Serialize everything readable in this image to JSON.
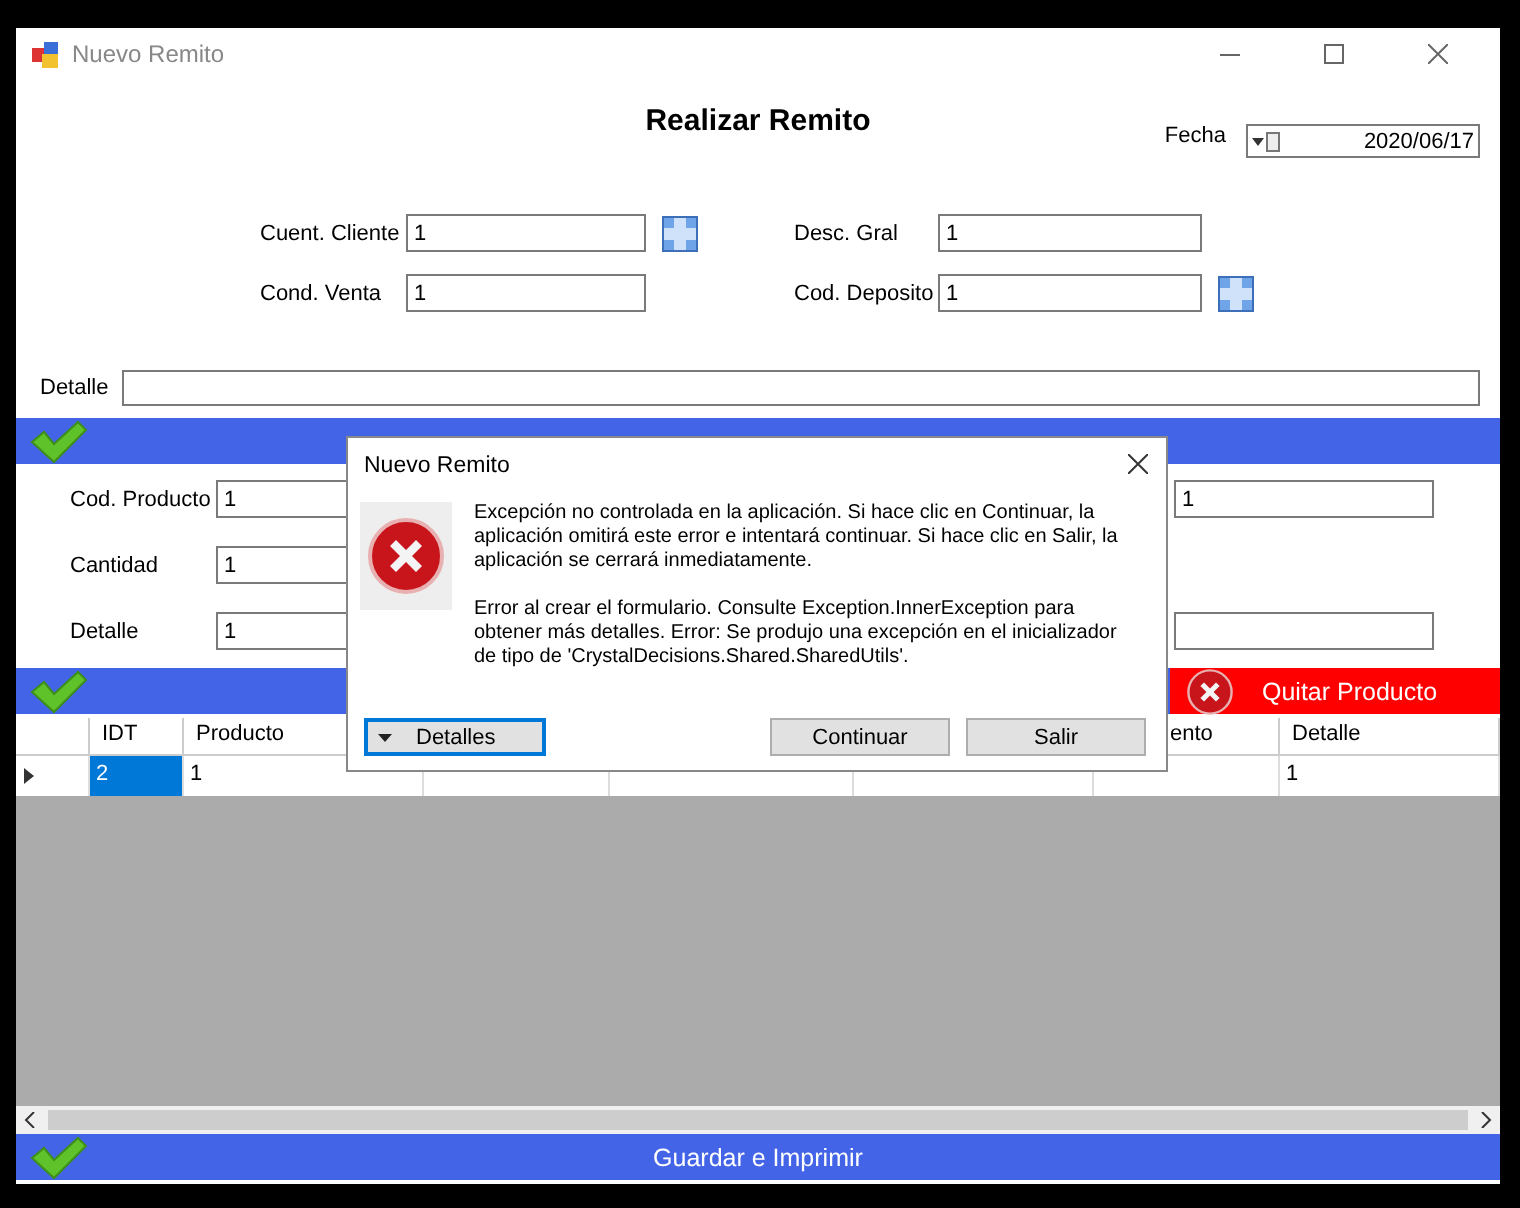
{
  "window": {
    "title": "Nuevo Remito"
  },
  "form": {
    "heading": "Realizar Remito",
    "date_label": "Fecha",
    "date_value": "2020/06/17",
    "fields": [
      {
        "label": "Cuent. Cliente",
        "value": "1",
        "lookup": true
      },
      {
        "label": "Desc. Gral",
        "value": "1",
        "lookup": false
      },
      {
        "label": "Cond. Venta",
        "value": "1",
        "lookup": false
      },
      {
        "label": "Cod. Deposito",
        "value": "1",
        "lookup": true
      }
    ],
    "detail": {
      "label": "Detalle"
    }
  },
  "product_section": {
    "rows": [
      {
        "kind": "pair",
        "label": "Cod. Producto",
        "value": "1",
        "right_value": "1"
      },
      {
        "kind": "single",
        "label": "Cantidad",
        "value": "1"
      },
      {
        "kind": "pair",
        "label": "Detalle",
        "value": "1"
      }
    ],
    "remove_button": "Quitar Producto"
  },
  "table": {
    "columns": [
      "IDT",
      "Producto",
      null,
      null,
      null,
      "ento",
      "Detalle"
    ],
    "rows": [
      {
        "cells": [
          {
            "text": "2",
            "selected": true
          },
          {
            "text": "1",
            "selected": false
          },
          {
            "selected": false
          },
          {
            "selected": false
          },
          {
            "selected": false
          },
          {
            "selected": false
          },
          {
            "text": "1",
            "selected": false
          }
        ]
      }
    ]
  },
  "save_button": "Guardar e Imprimir",
  "dialog": {
    "title": "Nuevo Remito",
    "paragraphs": [
      "Excepción no controlada en la aplicación. Si hace clic en Continuar, la aplicación omitirá este error e intentará continuar. Si hace clic en Salir, la aplicación se cerrará inmediatamente.",
      "Error al crear el formulario. Consulte Exception.InnerException para obtener más detalles. Error: Se produjo una excepción en el inicializador de tipo de 'CrystalDecisions.Shared.SharedUtils'."
    ],
    "details_button": {
      "label": "Detalles",
      "focused": true
    },
    "buttons": [
      {
        "label": "Continuar",
        "focused": false
      },
      {
        "label": "Salir",
        "focused": false
      }
    ]
  }
}
